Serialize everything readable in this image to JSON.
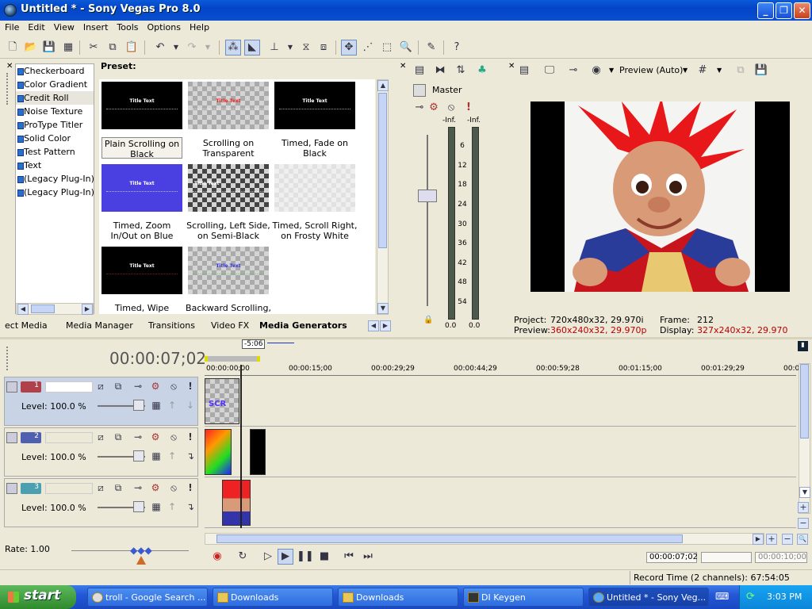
{
  "window": {
    "title": "Untitled * - Sony Vegas Pro 8.0"
  },
  "menu": [
    "File",
    "Edit",
    "View",
    "Insert",
    "Tools",
    "Options",
    "Help"
  ],
  "generators": {
    "items": [
      "Checkerboard",
      "Color Gradient",
      "Credit Roll",
      "Noise Texture",
      "ProType Titler",
      "Solid Color",
      "Test Pattern",
      "Text",
      "(Legacy Plug-In) T",
      "(Legacy Plug-In) V"
    ],
    "selected": "Credit Roll",
    "preset_label": "Preset:",
    "presets": [
      {
        "caption": "Plain Scrolling on Black",
        "thumb_title": "Title Text"
      },
      {
        "caption": "Scrolling on Transparent",
        "thumb_title": "Title Text"
      },
      {
        "caption": "Timed, Fade on Black",
        "thumb_title": "Title Text"
      },
      {
        "caption": "Timed, Zoom In/Out on Blue",
        "thumb_title": "Title Text"
      },
      {
        "caption": "Scrolling, Left Side, on Semi-Black",
        "thumb_title": "Title Text"
      },
      {
        "caption": "Timed, Scroll Right, on Frosty White",
        "thumb_title": ""
      },
      {
        "caption": "Timed, Wipe In/Out,",
        "thumb_title": "Title Text"
      },
      {
        "caption": "Backward Scrolling,",
        "thumb_title": "Title Text"
      }
    ]
  },
  "tabs": [
    "ect Media",
    "Media Manager",
    "Transitions",
    "Video FX",
    "Media Generators"
  ],
  "active_tab": "Media Generators",
  "mixer": {
    "label": "Master",
    "left_peak": "-Inf.",
    "right_peak": "-Inf.",
    "scale": [
      "6",
      "12",
      "18",
      "24",
      "30",
      "36",
      "42",
      "48",
      "54"
    ],
    "left_val": "0.0",
    "right_val": "0.0"
  },
  "preview": {
    "mode": "Preview (Auto)",
    "project_label": "Project:",
    "project": "720x480x32, 29.970i",
    "preview_label": "Preview:",
    "preview_val": "360x240x32, 29.970p",
    "frame_label": "Frame:",
    "frame": "212",
    "display_label": "Display:",
    "display": "327x240x32, 29.970"
  },
  "timeline": {
    "timecode": "00:00:07;02",
    "marker": "-5:06",
    "ruler": [
      "00:00:00;00",
      "00:00:15;00",
      "00:00:29;29",
      "00:00:44;29",
      "00:00:59;28",
      "00:01:15;00",
      "00:01:29;29",
      "00:0"
    ],
    "tracks": [
      {
        "num": "1",
        "level": "Level: 100.0 %",
        "color": "#b0404a"
      },
      {
        "num": "2",
        "level": "Level: 100.0 %",
        "color": "#5060b0"
      },
      {
        "num": "3",
        "level": "Level: 100.0 %",
        "color": "#4aa0b0"
      }
    ],
    "rate": "Rate: 1.00",
    "cursor_tc": "00:00:07;02",
    "end_tc": "00:00:10;00"
  },
  "status": {
    "record_time": "Record Time (2 channels): 67:54:05"
  },
  "taskbar": {
    "start": "start",
    "tasks": [
      "troll - Google Search ...",
      "Downloads",
      "Downloads",
      "DI Keygen",
      "Untitled * - Sony Veg..."
    ],
    "clock": "3:03 PM"
  }
}
